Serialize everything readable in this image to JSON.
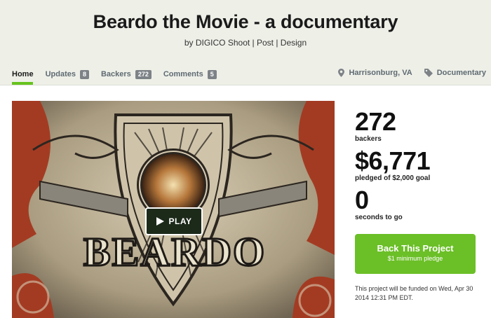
{
  "project": {
    "title": "Beardo the Movie - a documentary",
    "byline": "by DIGICO Shoot | Post | Design"
  },
  "tabs": [
    {
      "label": "Home",
      "count": null
    },
    {
      "label": "Updates",
      "count": "8"
    },
    {
      "label": "Backers",
      "count": "272"
    },
    {
      "label": "Comments",
      "count": "5"
    }
  ],
  "meta": {
    "location": "Harrisonburg, VA",
    "category": "Documentary"
  },
  "video": {
    "play_label": "PLAY",
    "poster_text": "BEARDO"
  },
  "stats": {
    "backers_count": "272",
    "backers_label": "backers",
    "pledged_amount": "$6,771",
    "pledged_label": "pledged of $2,000 goal",
    "time_value": "0",
    "time_label": "seconds to go"
  },
  "cta": {
    "label": "Back This Project",
    "sublabel": "$1 minimum pledge"
  },
  "funding_note": "This project will be funded on Wed, Apr 30 2014 12:31 PM EDT.",
  "colors": {
    "accent": "#6bbf27",
    "header_bg": "#eef0e8",
    "badge": "#7d8287"
  }
}
